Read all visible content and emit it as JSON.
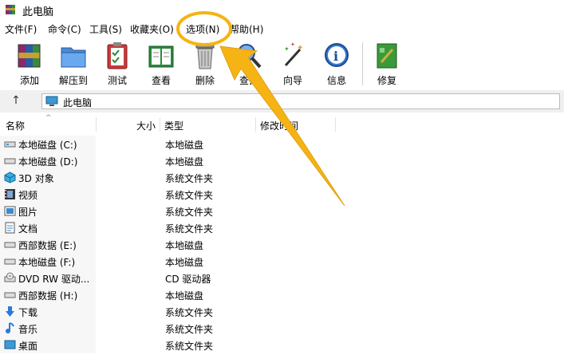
{
  "window": {
    "title": "此电脑"
  },
  "menu": [
    "文件(F)",
    "命令(C)",
    "工具(S)",
    "收藏夹(O)",
    "选项(N)",
    "帮助(H)"
  ],
  "toolbar": {
    "buttons": [
      {
        "label": "添加",
        "icon": "add-archive-icon"
      },
      {
        "label": "解压到",
        "icon": "extract-folder-icon"
      },
      {
        "label": "测试",
        "icon": "test-clipboard-icon"
      },
      {
        "label": "查看",
        "icon": "view-book-icon"
      },
      {
        "label": "删除",
        "icon": "trash-icon"
      },
      {
        "label": "查找",
        "icon": "magnifier-icon"
      },
      {
        "label": "向导",
        "icon": "wizard-wand-icon"
      },
      {
        "label": "信息",
        "icon": "info-icon"
      },
      {
        "label": "修复",
        "icon": "repair-book-icon"
      }
    ]
  },
  "address": {
    "path": "此电脑"
  },
  "columns": {
    "name": "名称",
    "size": "大小",
    "type": "类型",
    "modified": "修改时间"
  },
  "files": [
    {
      "name": "本地磁盘 (C:)",
      "type": "本地磁盘",
      "icon": "drive-icon"
    },
    {
      "name": "本地磁盘 (D:)",
      "type": "本地磁盘",
      "icon": "drive-icon"
    },
    {
      "name": "3D 对象",
      "type": "系统文件夹",
      "icon": "3d-objects-icon"
    },
    {
      "name": "视频",
      "type": "系统文件夹",
      "icon": "video-icon"
    },
    {
      "name": "图片",
      "type": "系统文件夹",
      "icon": "picture-icon"
    },
    {
      "name": "文档",
      "type": "系统文件夹",
      "icon": "document-icon"
    },
    {
      "name": "西部数据 (E:)",
      "type": "本地磁盘",
      "icon": "drive-icon"
    },
    {
      "name": "本地磁盘 (F:)",
      "type": "本地磁盘",
      "icon": "drive-icon"
    },
    {
      "name": "DVD RW 驱动...",
      "type": "CD 驱动器",
      "icon": "dvd-icon"
    },
    {
      "name": "西部数据 (H:)",
      "type": "本地磁盘",
      "icon": "drive-icon"
    },
    {
      "name": "下载",
      "type": "系统文件夹",
      "icon": "download-icon"
    },
    {
      "name": "音乐",
      "type": "系统文件夹",
      "icon": "music-icon"
    },
    {
      "name": "桌面",
      "type": "系统文件夹",
      "icon": "desktop-icon"
    }
  ],
  "annotation": {
    "color": "#f5b414",
    "highlight_target": "选项(N)"
  }
}
